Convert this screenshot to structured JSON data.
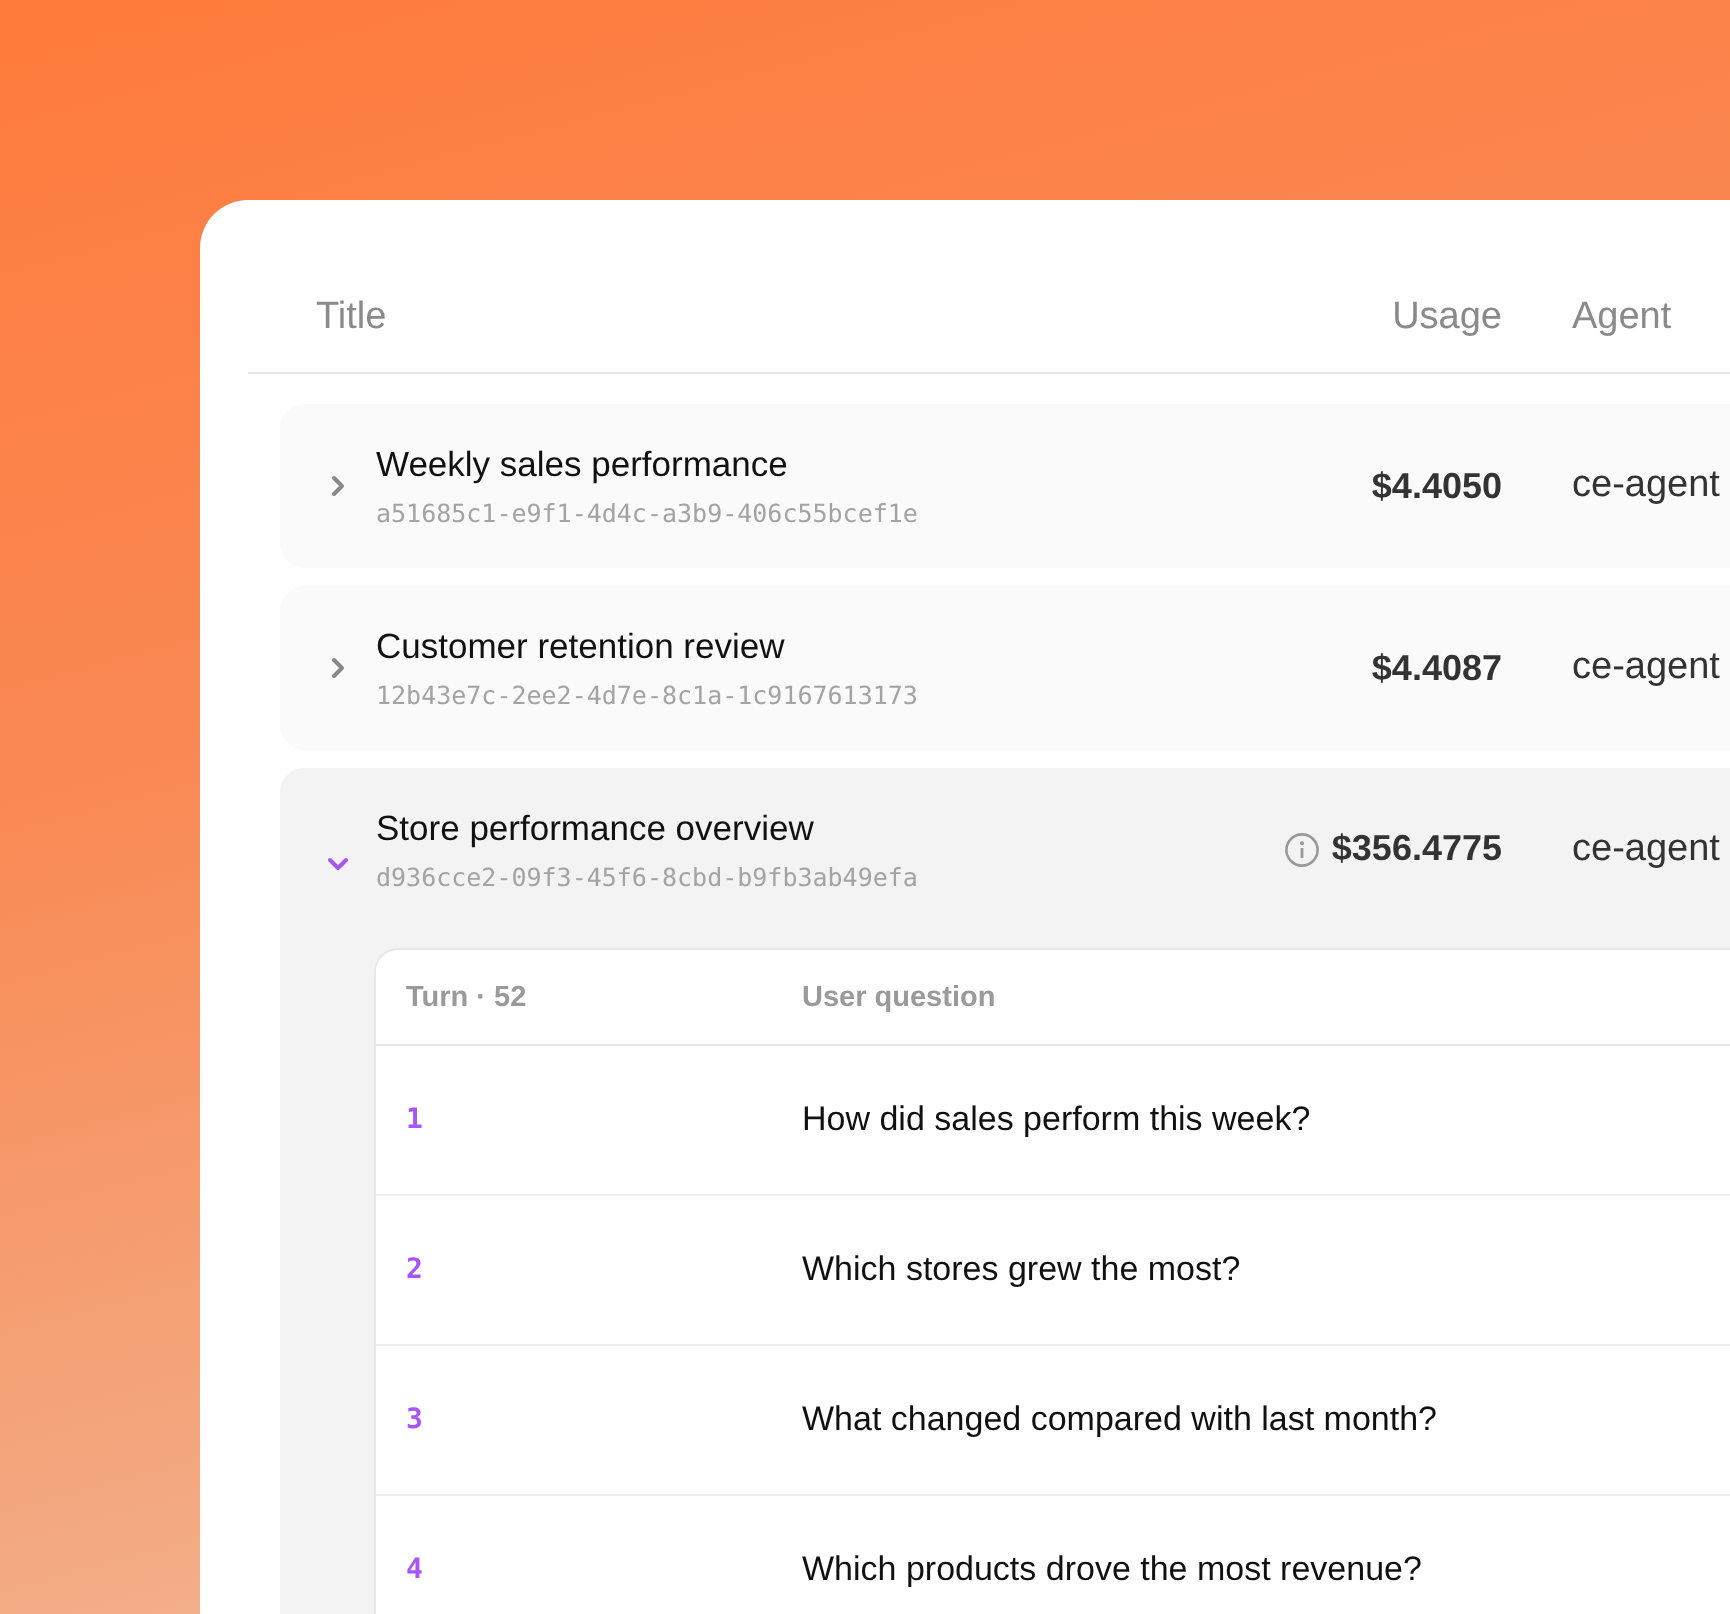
{
  "table": {
    "columns": [
      "Title",
      "Usage",
      "Agent"
    ],
    "rows": [
      {
        "title": "Weekly sales performance",
        "id": "a51685c1-e9f1-4d4c-a3b9-406c55bcef1e",
        "usage": "$4.4050",
        "agent": "ce-agent",
        "expanded": false,
        "usage_note": false
      },
      {
        "title": "Customer retention review",
        "id": "12b43e7c-2ee2-4d7e-8c1a-1c9167613173",
        "usage": "$4.4087",
        "agent": "ce-agent",
        "expanded": false,
        "usage_note": false
      },
      {
        "title": "Store performance overview",
        "id": "d936cce2-09f3-45f6-8cbd-b9fb3ab49efa",
        "usage": "$356.4775",
        "agent": "ce-agent",
        "expanded": true,
        "usage_note": true,
        "turns": {
          "columns": [
            "Turn · 52",
            "User question"
          ],
          "rows": [
            {
              "turn": "1",
              "question": "How did sales perform this week?"
            },
            {
              "turn": "2",
              "question": "Which stores grew the most?"
            },
            {
              "turn": "3",
              "question": "What changed compared with last month?"
            },
            {
              "turn": "4",
              "question": "Which products drove the most revenue?"
            }
          ]
        }
      }
    ]
  }
}
